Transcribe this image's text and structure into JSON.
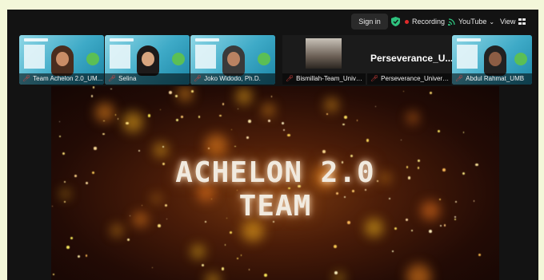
{
  "topbar": {
    "signin_label": "Sign in",
    "shield_icon": "shield-check-icon",
    "shield_color": "#2ec27e",
    "recording_label": "Recording",
    "recording_color": "#e02b2b",
    "youtube_label": "YouTube",
    "youtube_icon": "broadcast-icon",
    "view_label": "View",
    "view_icon": "grid-icon"
  },
  "participants": [
    {
      "name": "Team Achelon 2.0_UM..."
    },
    {
      "name": "Selina"
    },
    {
      "name": "Joko Widodo, Ph.D."
    },
    {
      "name": "Bismillah-Team_Univer..."
    },
    {
      "name": "Perseverance_Universi..."
    },
    {
      "name": "Abdul Rahmat_UMB"
    }
  ],
  "spotlight_name": "Perseverance_U...",
  "stage": {
    "title_line1": "ACHELON 2.0",
    "title_line2": "TEAM"
  }
}
